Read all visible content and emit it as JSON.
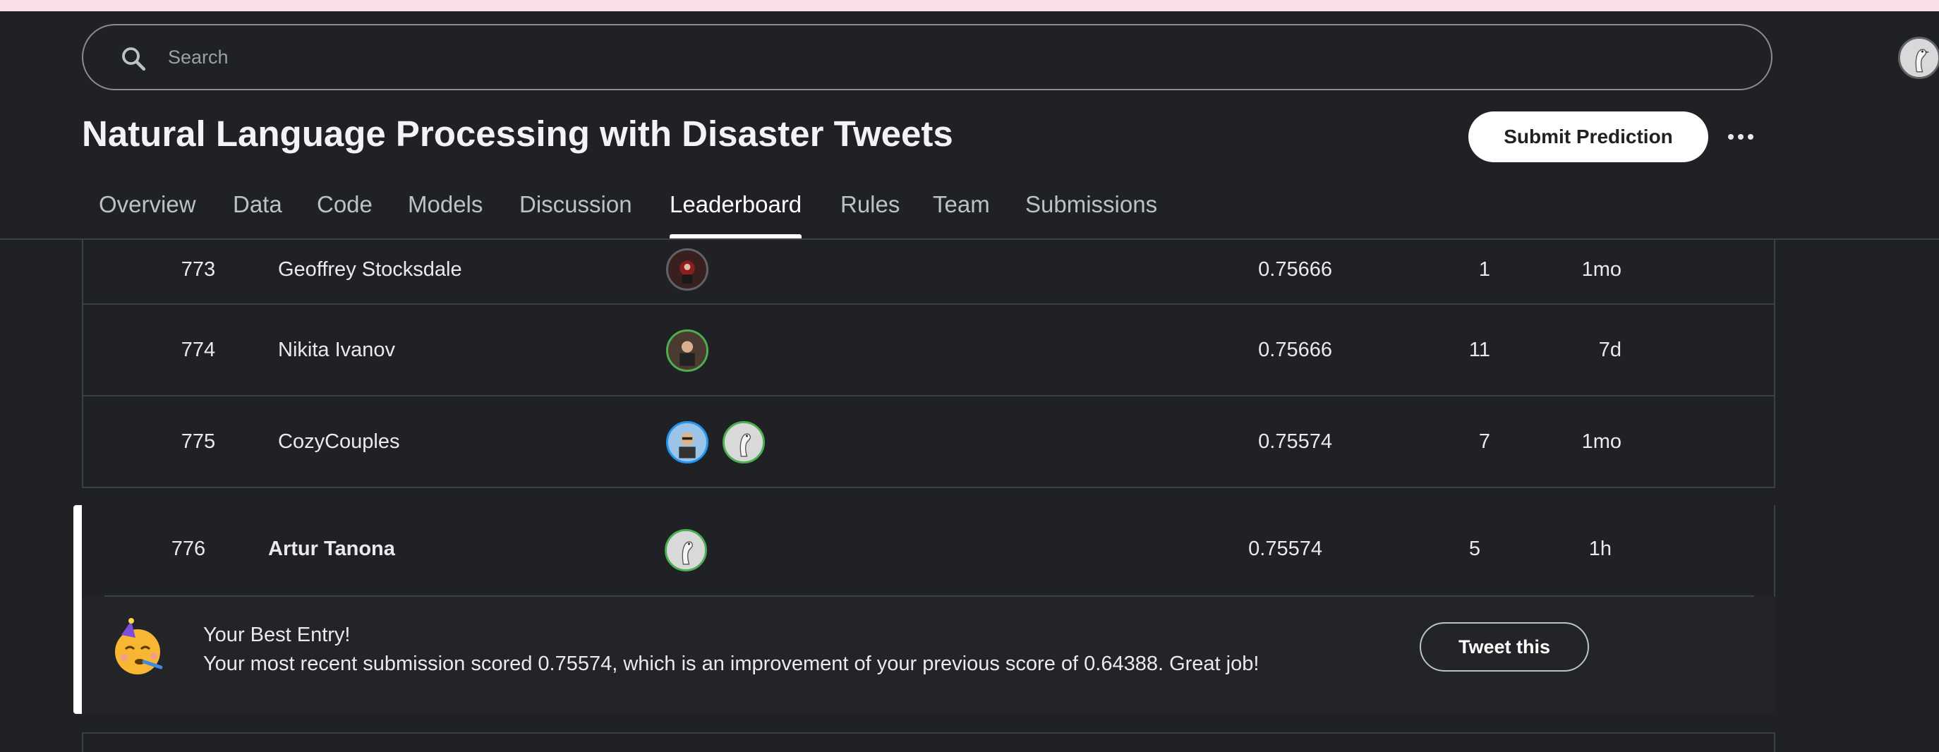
{
  "header": {
    "search_placeholder": "Search",
    "title": "Natural Language Processing with Disaster Tweets",
    "submit_label": "Submit Prediction"
  },
  "tabs": [
    {
      "label": "Overview"
    },
    {
      "label": "Data"
    },
    {
      "label": "Code"
    },
    {
      "label": "Models"
    },
    {
      "label": "Discussion"
    },
    {
      "label": "Leaderboard",
      "active": true
    },
    {
      "label": "Rules"
    },
    {
      "label": "Team"
    },
    {
      "label": "Submissions"
    }
  ],
  "leaderboard": {
    "rows": [
      {
        "rank": "773",
        "team": "Geoffrey Stocksdale",
        "score": "0.75666",
        "entries": "1",
        "last": "1mo"
      },
      {
        "rank": "774",
        "team": "Nikita Ivanov",
        "score": "0.75666",
        "entries": "11",
        "last": "7d"
      },
      {
        "rank": "775",
        "team": "CozyCouples",
        "score": "0.75574",
        "entries": "7",
        "last": "1mo"
      }
    ],
    "user_row": {
      "rank": "776",
      "team": "Artur Tanona",
      "score": "0.75574",
      "entries": "5",
      "last": "1h"
    }
  },
  "best_entry": {
    "title": "Your Best Entry!",
    "message": "Your most recent submission scored 0.75574, which is an improvement of your previous score of 0.64388. Great job!",
    "tweet_label": "Tweet this"
  },
  "colors": {
    "background": "#202124",
    "accent": "#ffffff",
    "top_strip": "#f9dfe6",
    "tier_ring_green": "#4caf50",
    "tier_ring_blue": "#2196f3"
  }
}
